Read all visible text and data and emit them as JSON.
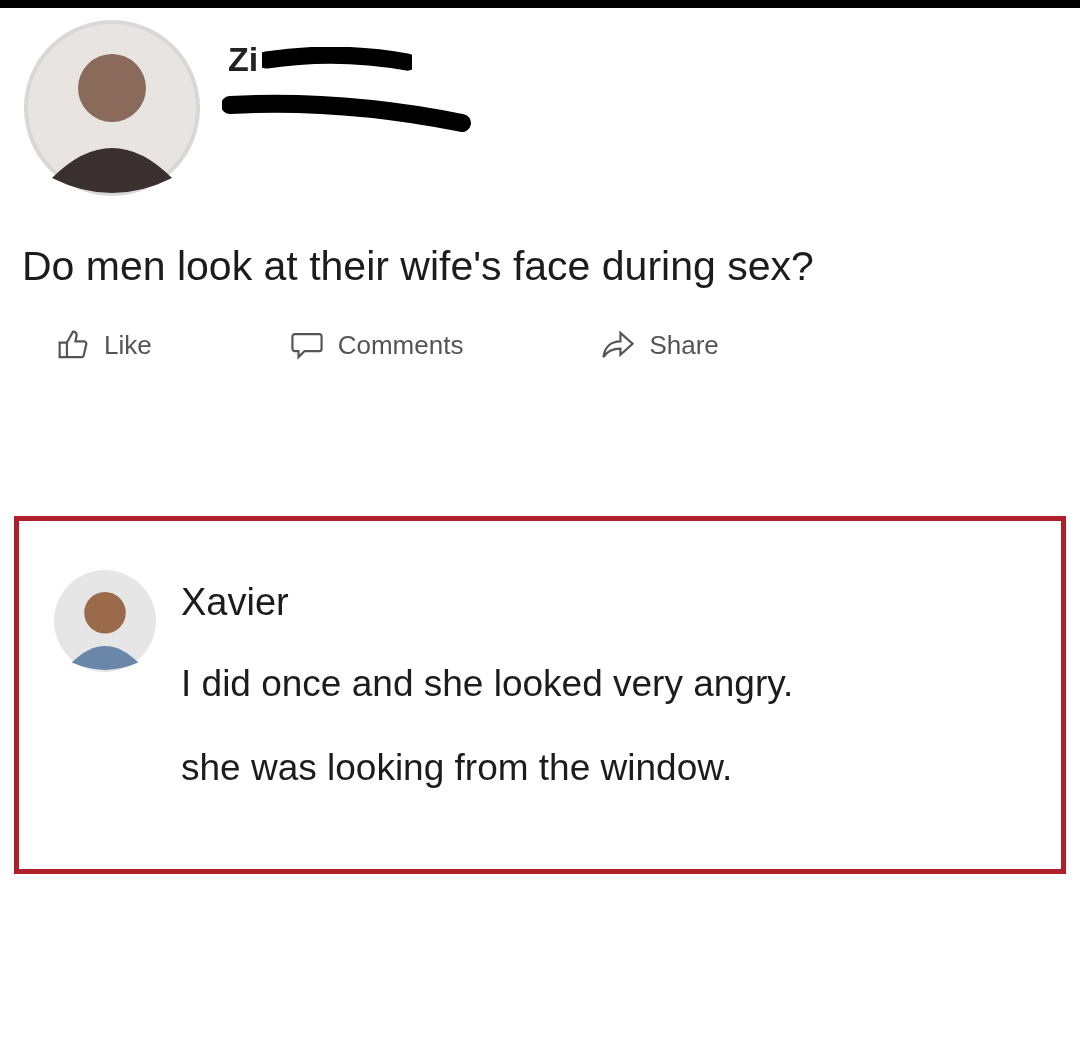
{
  "post": {
    "author": {
      "name": "Zi"
    },
    "text": "Do men look at their wife's face during sex?",
    "actions": [
      {
        "kind": "like",
        "label": "Like"
      },
      {
        "kind": "comment",
        "label": "Comments"
      },
      {
        "kind": "share",
        "label": "Share"
      }
    ]
  },
  "comment": {
    "author": "Xavier",
    "lines": [
      "I did once and she looked very angry.",
      "she was looking from the window."
    ]
  }
}
